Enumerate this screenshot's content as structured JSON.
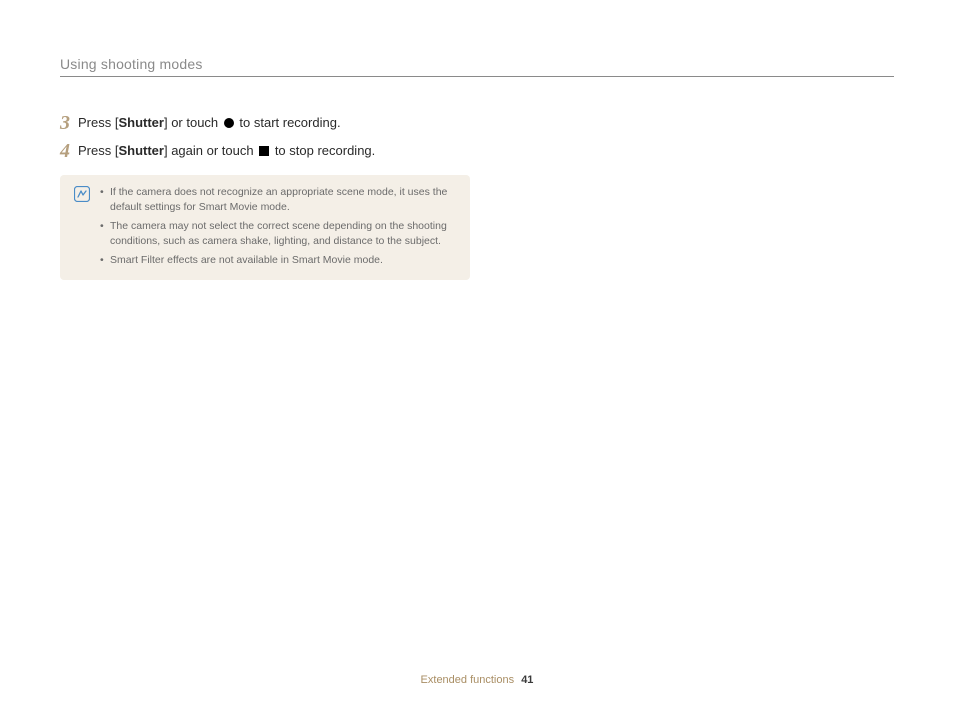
{
  "header": {
    "title": "Using shooting modes"
  },
  "steps": [
    {
      "num": "3",
      "text_a": "Press [",
      "text_b": "Shutter",
      "text_c": "] or touch ",
      "icon": "circle",
      "text_d": " to start recording."
    },
    {
      "num": "4",
      "text_a": "Press [",
      "text_b": "Shutter",
      "text_c": "] again or touch ",
      "icon": "square",
      "text_d": " to stop recording."
    }
  ],
  "notes": [
    "If the camera does not recognize an appropriate scene mode, it uses the default settings for Smart Movie mode.",
    "The camera may not select the correct scene depending on the shooting conditions, such as camera shake, lighting, and distance to the subject.",
    "Smart Filter effects are not available in Smart Movie mode."
  ],
  "footer": {
    "section": "Extended functions",
    "page": "41"
  }
}
